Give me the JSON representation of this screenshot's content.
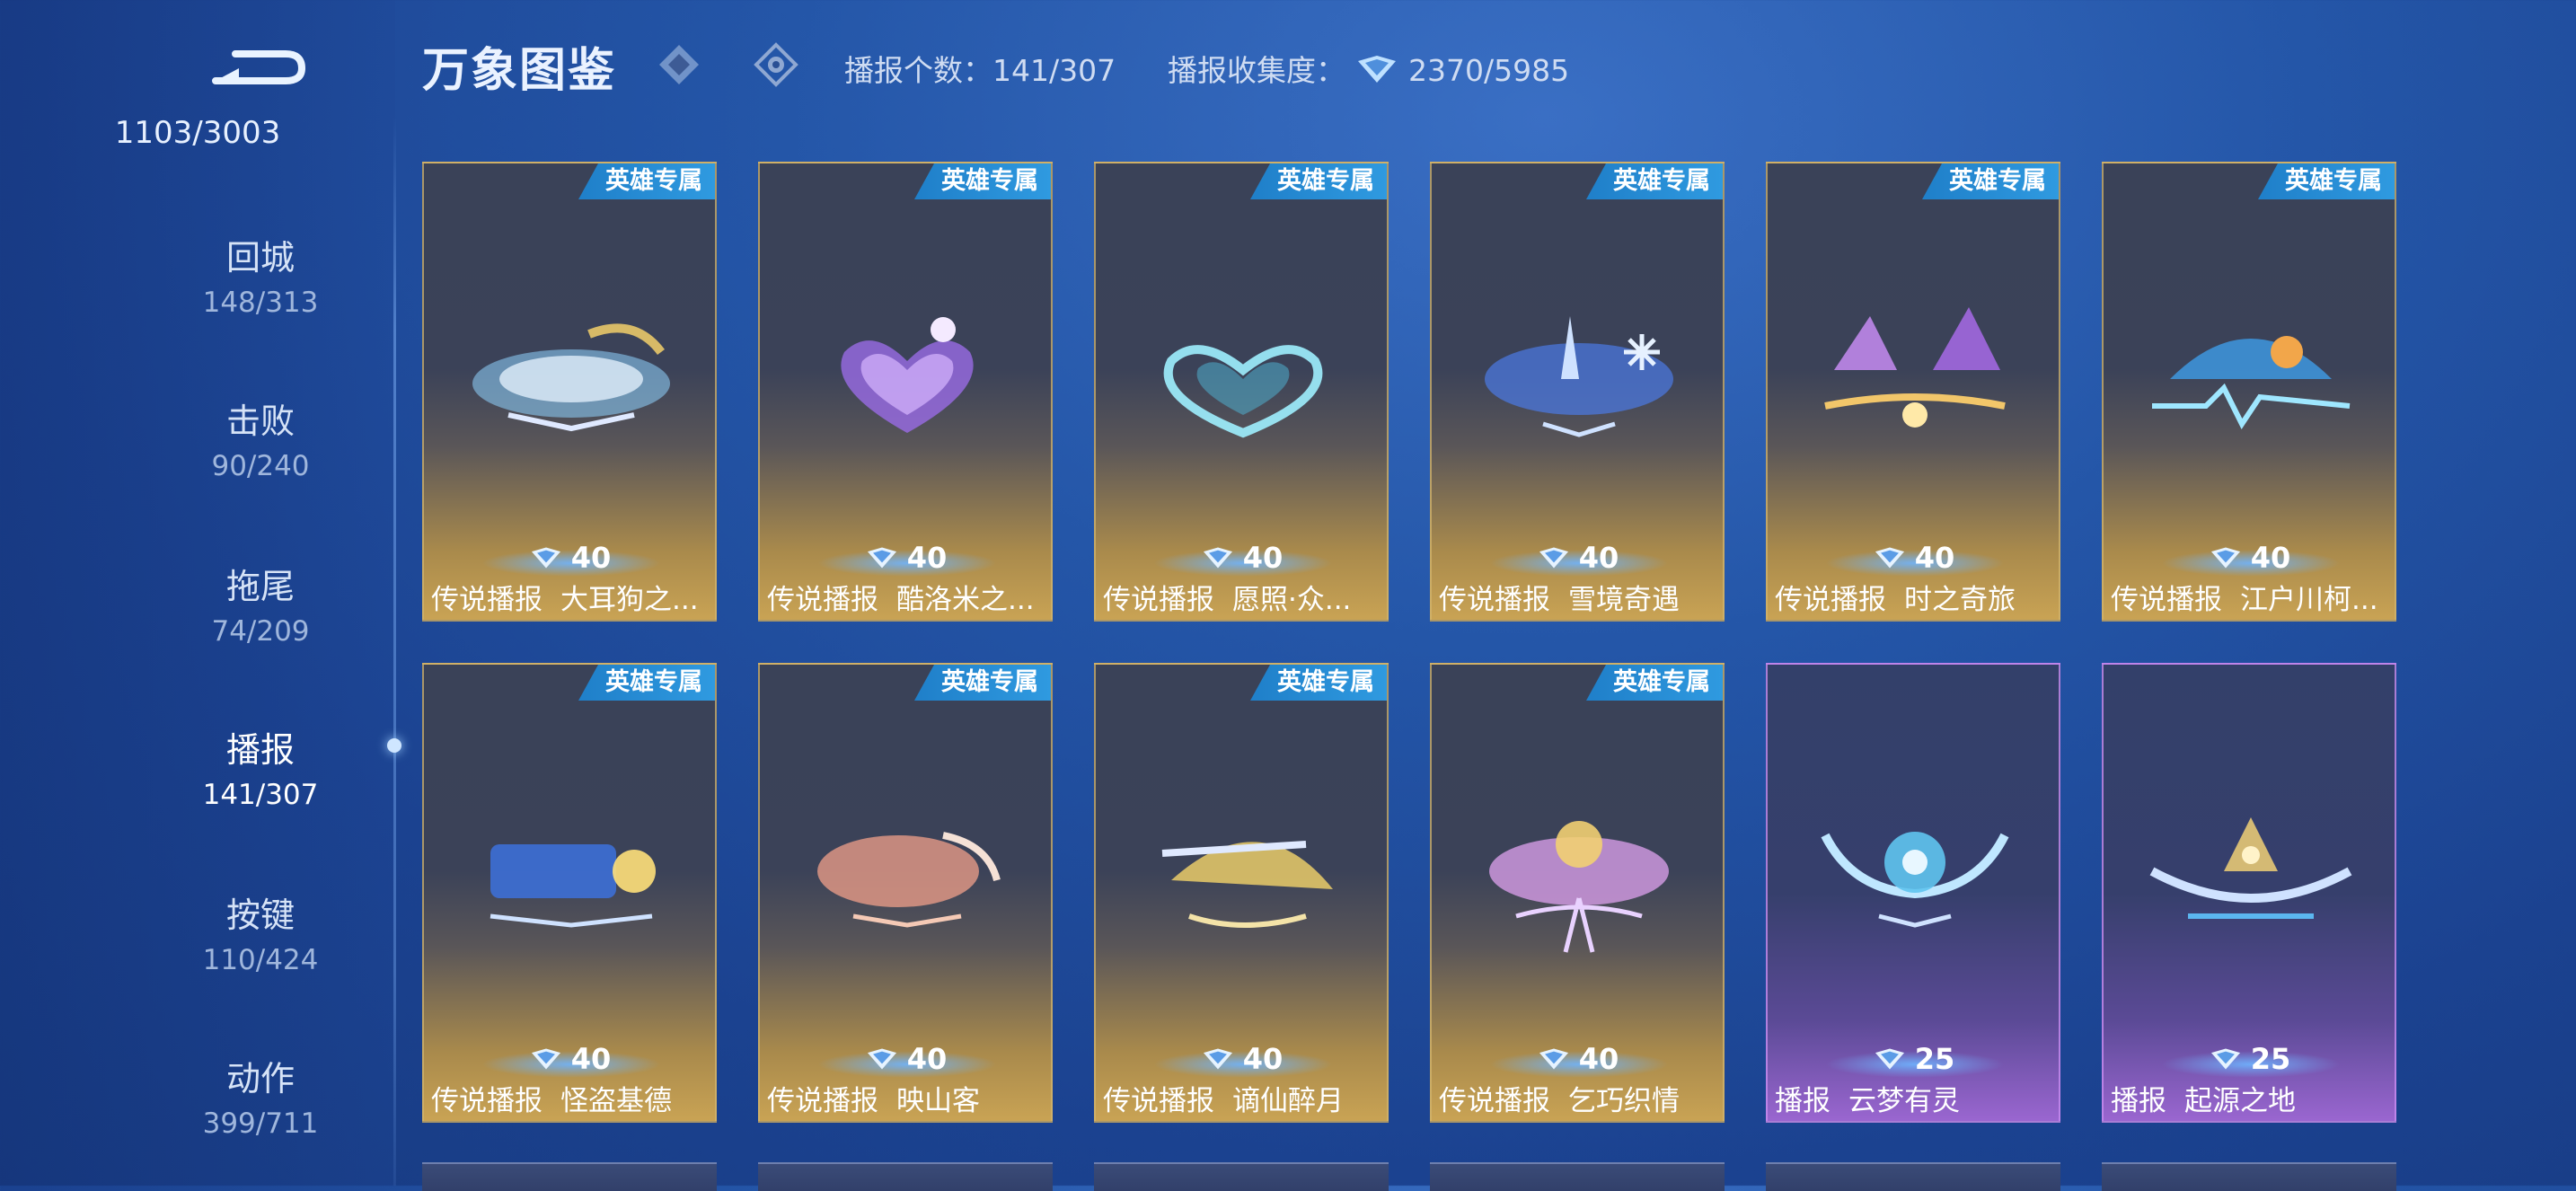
{
  "header": {
    "title": "万象图鉴",
    "broadcast_count_label": "播报个数：",
    "broadcast_count": "141/307",
    "collection_label": "播报收集度：",
    "collection_value": "2370/5985"
  },
  "sidebar": {
    "total": "1103/3003",
    "items": [
      {
        "label": "回城",
        "count": "148/313"
      },
      {
        "label": "击败",
        "count": "90/240"
      },
      {
        "label": "拖尾",
        "count": "74/209"
      },
      {
        "label": "播报",
        "count": "141/307"
      },
      {
        "label": "按键",
        "count": "110/424"
      },
      {
        "label": "动作",
        "count": "399/711"
      }
    ]
  },
  "cards": [
    {
      "tag": "英雄专属",
      "price": "40",
      "type": "传说播报",
      "name": "大耳狗之..."
    },
    {
      "tag": "英雄专属",
      "price": "40",
      "type": "传说播报",
      "name": "酷洛米之..."
    },
    {
      "tag": "英雄专属",
      "price": "40",
      "type": "传说播报",
      "name": "愿照·众..."
    },
    {
      "tag": "英雄专属",
      "price": "40",
      "type": "传说播报",
      "name": "雪境奇遇"
    },
    {
      "tag": "英雄专属",
      "price": "40",
      "type": "传说播报",
      "name": "时之奇旅"
    },
    {
      "tag": "英雄专属",
      "price": "40",
      "type": "传说播报",
      "name": "江户川柯..."
    },
    {
      "tag": "英雄专属",
      "price": "40",
      "type": "传说播报",
      "name": "怪盗基德"
    },
    {
      "tag": "英雄专属",
      "price": "40",
      "type": "传说播报",
      "name": "映山客"
    },
    {
      "tag": "英雄专属",
      "price": "40",
      "type": "传说播报",
      "name": "谪仙醉月"
    },
    {
      "tag": "英雄专属",
      "price": "40",
      "type": "传说播报",
      "name": "乞巧织情"
    },
    {
      "tag": "",
      "price": "25",
      "type": "播报",
      "name": "云梦有灵"
    },
    {
      "tag": "",
      "price": "25",
      "type": "播报",
      "name": "起源之地"
    }
  ],
  "colors": {
    "accent_blue": "#2f9ae0",
    "gold": "#c9a354",
    "purple": "#9a66d0"
  },
  "icons": [
    "back-arrow-icon",
    "diamond-filter-icon",
    "eye-filter-icon",
    "gem-icon"
  ]
}
